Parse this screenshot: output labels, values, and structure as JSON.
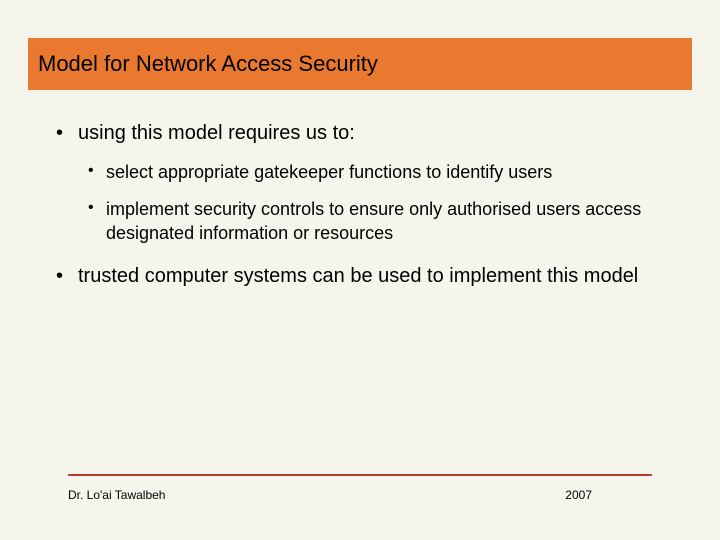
{
  "title": "Model for Network Access Security",
  "bullets": {
    "b0": "using this model requires us to:",
    "b0_sub0": "select appropriate gatekeeper functions to identify users",
    "b0_sub1": "implement security controls to ensure only authorised users access designated information or resources",
    "b1": "trusted computer systems can be used to implement this model"
  },
  "footer": {
    "author": "Dr. Lo'ai Tawalbeh",
    "year": "2007"
  },
  "colors": {
    "accent": "#e8792f",
    "rule": "#b63a2a",
    "bg": "#f5f5eb"
  }
}
